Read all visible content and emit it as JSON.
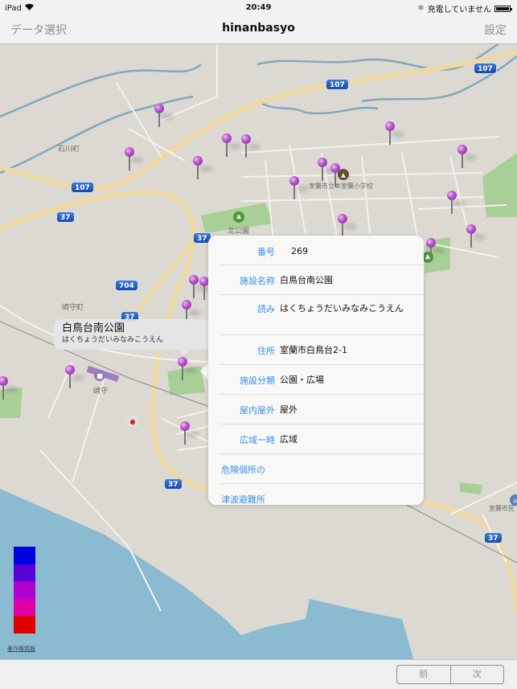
{
  "status_bar": {
    "device": "iPad",
    "time": "20:49",
    "charging_status": "充電していません"
  },
  "nav_bar": {
    "left_button": "データ選択",
    "title": "hinanbasyo",
    "right_button": "設定"
  },
  "map": {
    "place_labels": [
      "石川町",
      "崎守町",
      "崎守",
      "北公園",
      "室蘭市立本室蘭小学校",
      "室蘭市民"
    ],
    "route_shields": [
      "107",
      "107",
      "107",
      "37",
      "37",
      "37",
      "704",
      "37",
      "37"
    ],
    "callout": {
      "title": "白鳥台南公園",
      "subtitle": "はくちょうだいみなみこうえん"
    },
    "legend_colors": [
      "#0000e0",
      "#5a00d8",
      "#b000d0",
      "#e000a8",
      "#e00000"
    ],
    "copyright_link": "著作権情報"
  },
  "popover": {
    "rows": [
      {
        "key": "番号",
        "value": "269"
      },
      {
        "key": "施設名称",
        "value": "白鳥台南公園"
      },
      {
        "key": "読み",
        "value": "はくちょうだいみなみこうえん"
      },
      {
        "key": "住所",
        "value": "室蘭市白鳥台2-1"
      },
      {
        "key": "施設分類",
        "value": "公園・広場"
      },
      {
        "key": "屋内屋外",
        "value": "屋外"
      },
      {
        "key": "広域一時",
        "value": "広域"
      },
      {
        "key": "危険個所の",
        "value": ""
      },
      {
        "key": "津波避難所",
        "value": ""
      }
    ]
  },
  "toolbar": {
    "prev_label": "前",
    "next_label": "次"
  },
  "colors": {
    "accent": "#3a8ee6",
    "pin": "#b24fc7",
    "water": "#8abbd0",
    "land": "#dcd9d3",
    "park": "#9cc98a"
  }
}
